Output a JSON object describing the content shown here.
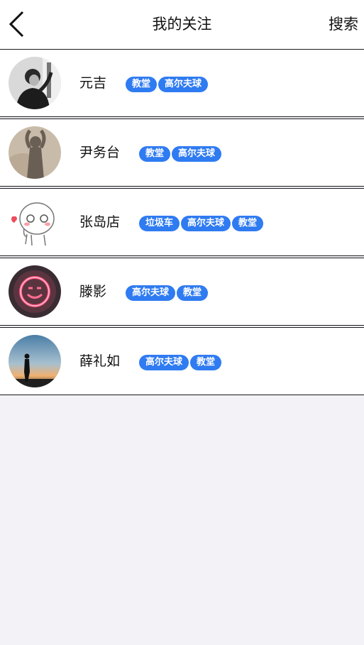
{
  "header": {
    "title": "我的关注",
    "search_label": "搜索"
  },
  "users": [
    {
      "name": "元吉",
      "tags": [
        "教堂",
        "高尔夫球"
      ],
      "avatar": "man-portrait-avatar"
    },
    {
      "name": "尹务台",
      "tags": [
        "教堂",
        "高尔夫球"
      ],
      "avatar": "shadow-silhouette-avatar"
    },
    {
      "name": "张岛店",
      "tags": [
        "垃圾车",
        "高尔夫球",
        "教堂"
      ],
      "avatar": "cartoon-face-avatar"
    },
    {
      "name": "滕影",
      "tags": [
        "高尔夫球",
        "教堂"
      ],
      "avatar": "neon-smiley-avatar"
    },
    {
      "name": "薛礼如",
      "tags": [
        "高尔夫球",
        "教堂"
      ],
      "avatar": "sunset-silhouette-avatar"
    }
  ],
  "colors": {
    "tag_bg": "#2f7bf1",
    "page_bg": "#f2f2f7"
  }
}
